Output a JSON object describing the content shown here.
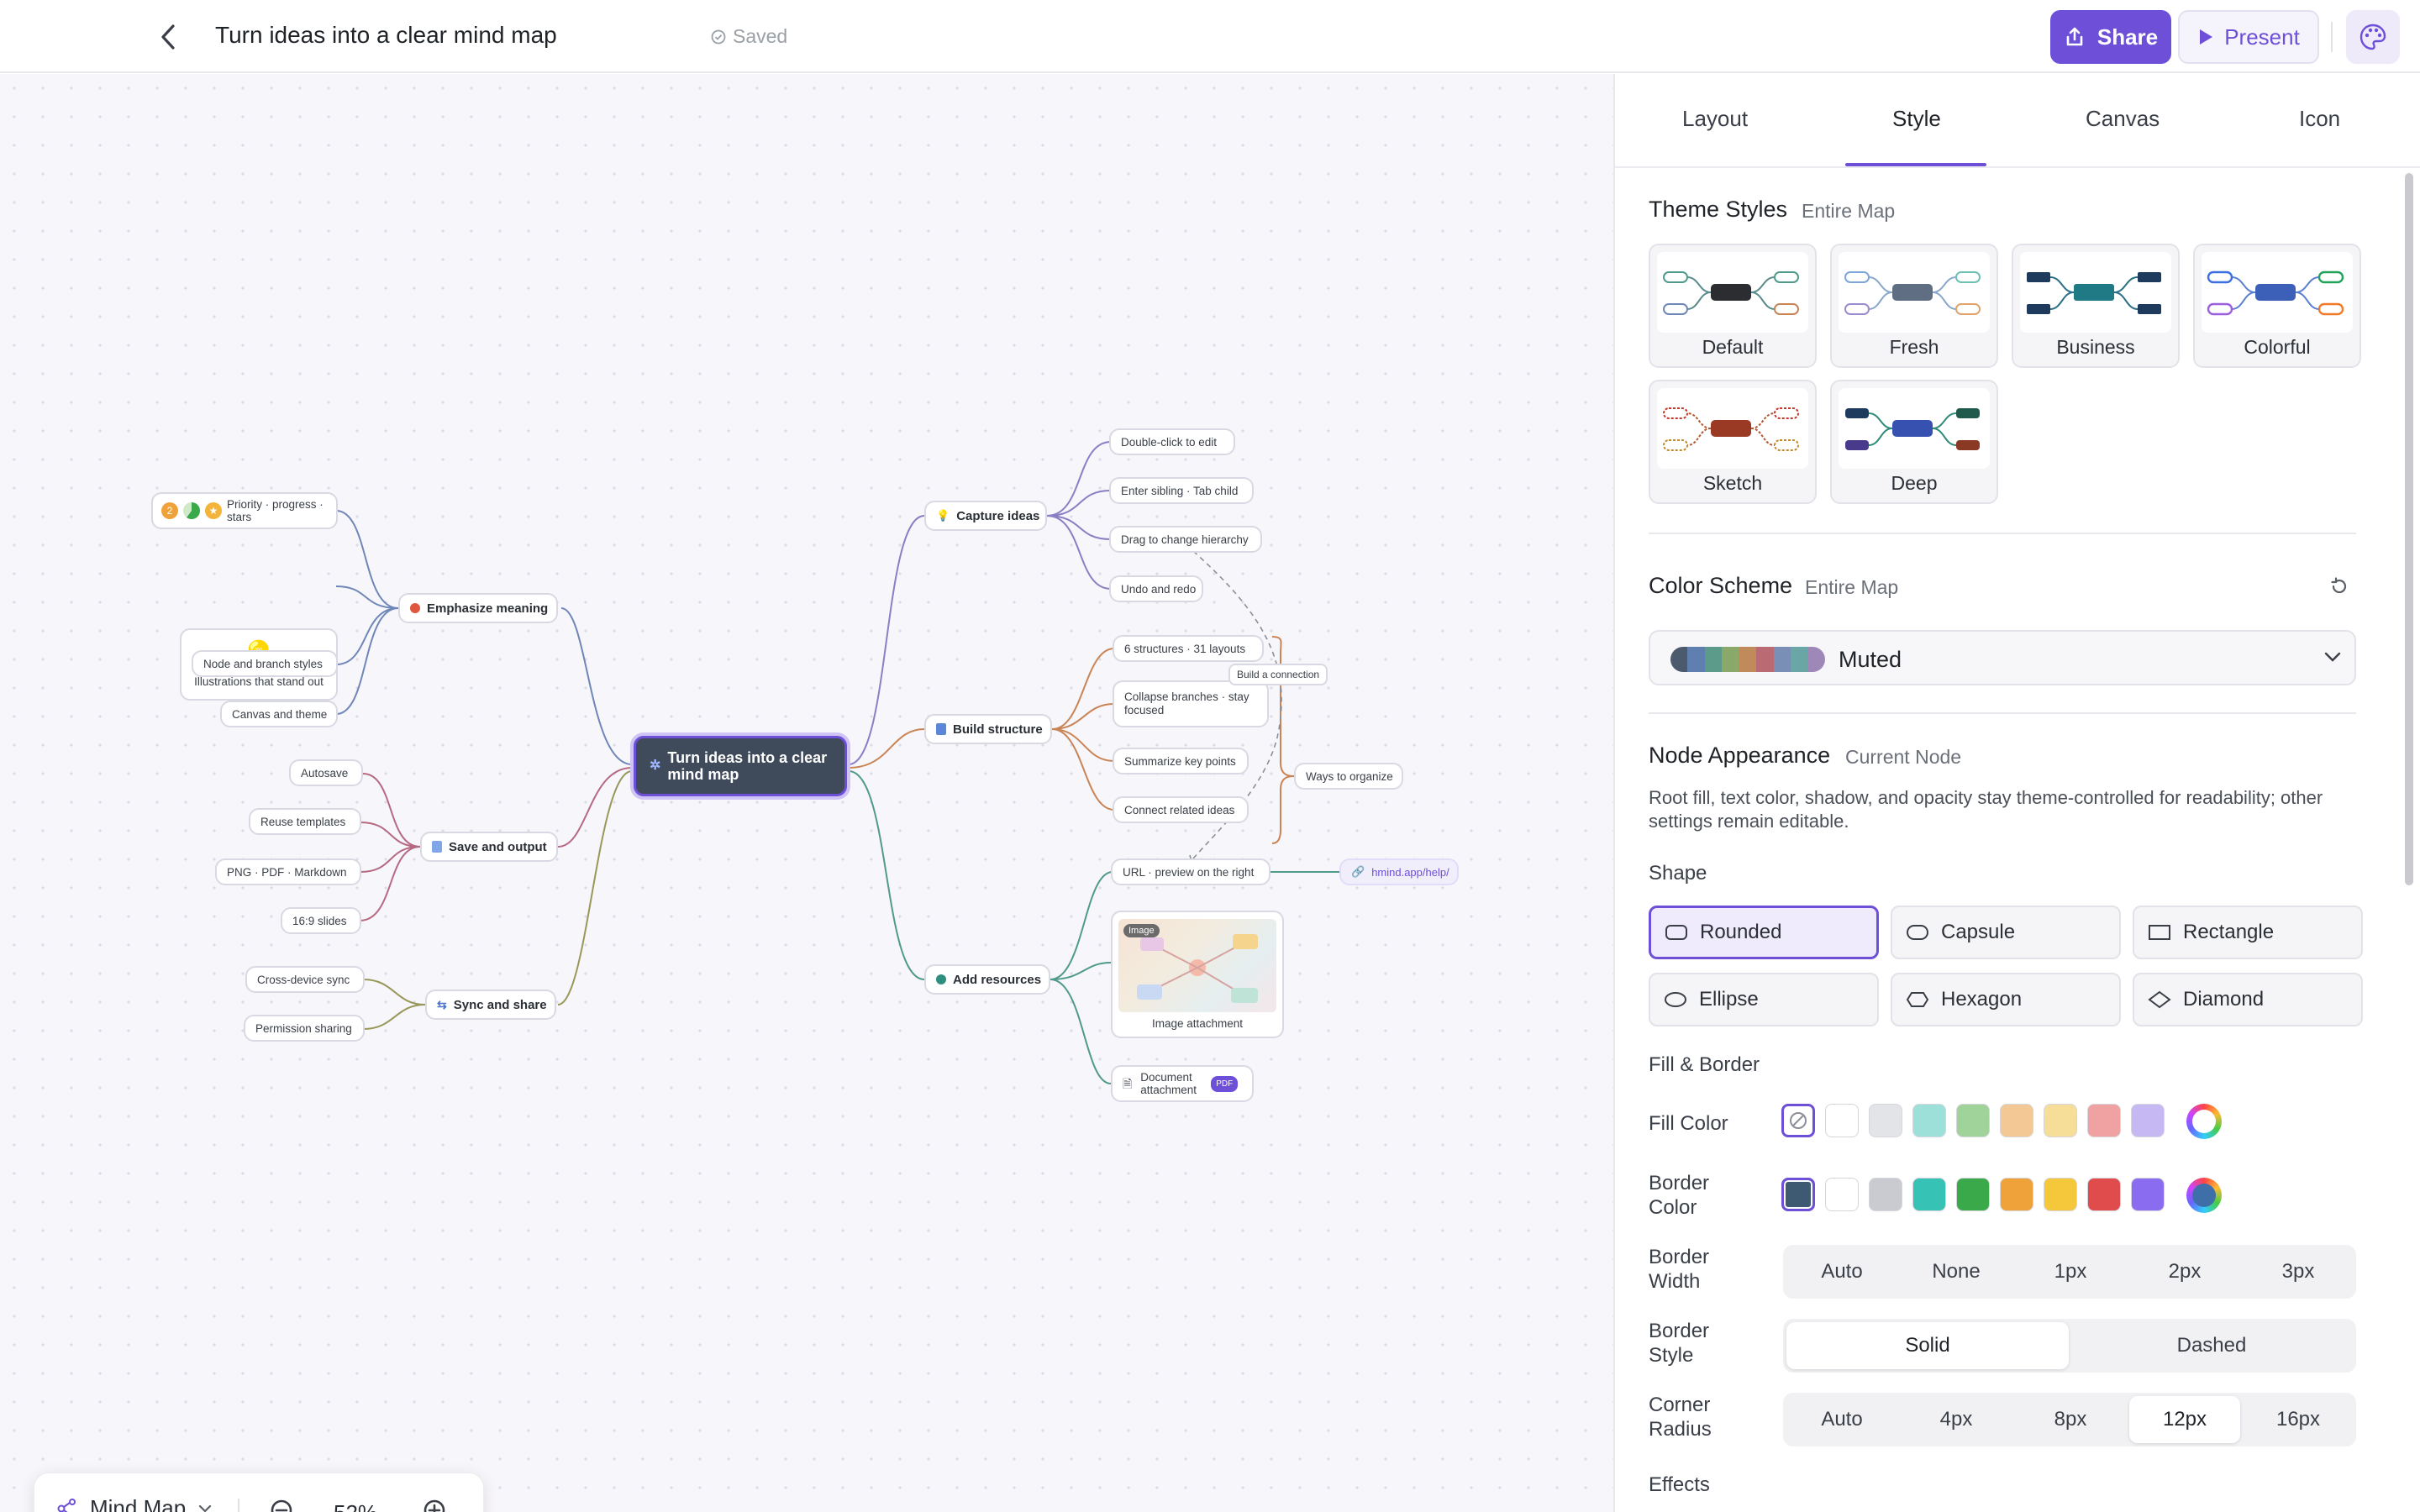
{
  "topbar": {
    "title": "Turn ideas into a clear mind map",
    "saved": "Saved",
    "share": "Share",
    "present": "Present"
  },
  "map": {
    "root": "Turn ideas into a clear mind map",
    "left": [
      {
        "label": "Emphasize meaning",
        "children": [
          "Priority · progress · stars",
          "Illustrations that stand out",
          "Node and branch styles",
          "Canvas and theme"
        ]
      },
      {
        "label": "Save and output",
        "children": [
          "Autosave",
          "Reuse templates",
          "PNG · PDF · Markdown",
          "16:9 slides"
        ]
      },
      {
        "label": "Sync and share",
        "children": [
          "Cross-device sync",
          "Permission sharing"
        ]
      }
    ],
    "right": [
      {
        "label": "Capture ideas",
        "children": [
          "Double-click to edit",
          "Enter sibling · Tab child",
          "Drag to change hierarchy",
          "Undo and redo"
        ]
      },
      {
        "label": "Build structure",
        "children": [
          "6 structures · 31 layouts",
          "Collapse branches · stay focused",
          "Summarize key points",
          "Connect related ideas"
        ],
        "summary": "Ways to organize",
        "connection": "Build a connection"
      },
      {
        "label": "Add resources",
        "children": [
          "URL · preview on the right",
          "Image attachment",
          "Document attachment"
        ],
        "link": "hmind.app/help/",
        "image_tag": "Image",
        "pdf_badge": "PDF"
      }
    ],
    "badge_number": "2"
  },
  "zoombar": {
    "mode": "Mind Map",
    "zoom": "52%"
  },
  "panel": {
    "tabs": [
      "Layout",
      "Style",
      "Canvas",
      "Icon"
    ],
    "active_tab": "Style",
    "theme_styles": {
      "title": "Theme Styles",
      "scope": "Entire Map",
      "items": [
        "Default",
        "Fresh",
        "Business",
        "Colorful",
        "Sketch",
        "Deep"
      ]
    },
    "color_scheme": {
      "title": "Color Scheme",
      "scope": "Entire Map",
      "value": "Muted",
      "swatches": [
        "#4c5a6e",
        "#5f7fb0",
        "#5c9a8a",
        "#8aa86a",
        "#c08a5a",
        "#b96a72",
        "#7a8fb5",
        "#6aa6a6",
        "#9d88b8"
      ]
    },
    "node_appearance": {
      "title": "Node Appearance",
      "scope": "Current Node",
      "description": "Root fill, text color, shadow, and opacity stay theme-controlled for readability; other settings remain editable."
    },
    "shape": {
      "label": "Shape",
      "options": [
        "Rounded",
        "Capsule",
        "Rectangle",
        "Ellipse",
        "Hexagon",
        "Diamond"
      ],
      "selected": "Rounded"
    },
    "fill_border": {
      "label": "Fill & Border"
    },
    "fill_color": {
      "label": "Fill Color",
      "colors": [
        "#ffffff",
        "#e3e4e8",
        "#9ddfd9",
        "#9fd39a",
        "#f4c895",
        "#f6de98",
        "#f0a1a1",
        "#c6b8f2"
      ]
    },
    "border_color": {
      "label": "Border Color",
      "colors": [
        "#3e5a73",
        "#ffffff",
        "#c9cbd0",
        "#36c2b4",
        "#3aa94a",
        "#f0a23a",
        "#f5c73b",
        "#e04b4b",
        "#8a6cf0"
      ]
    },
    "border_width": {
      "label": "Border Width",
      "options": [
        "Auto",
        "None",
        "1px",
        "2px",
        "3px"
      ]
    },
    "border_style": {
      "label": "Border Style",
      "options": [
        "Solid",
        "Dashed"
      ],
      "selected": "Solid"
    },
    "corner_radius": {
      "label": "Corner Radius",
      "options": [
        "Auto",
        "4px",
        "8px",
        "12px",
        "16px"
      ],
      "selected": "12px"
    },
    "effects": {
      "label": "Effects"
    }
  }
}
